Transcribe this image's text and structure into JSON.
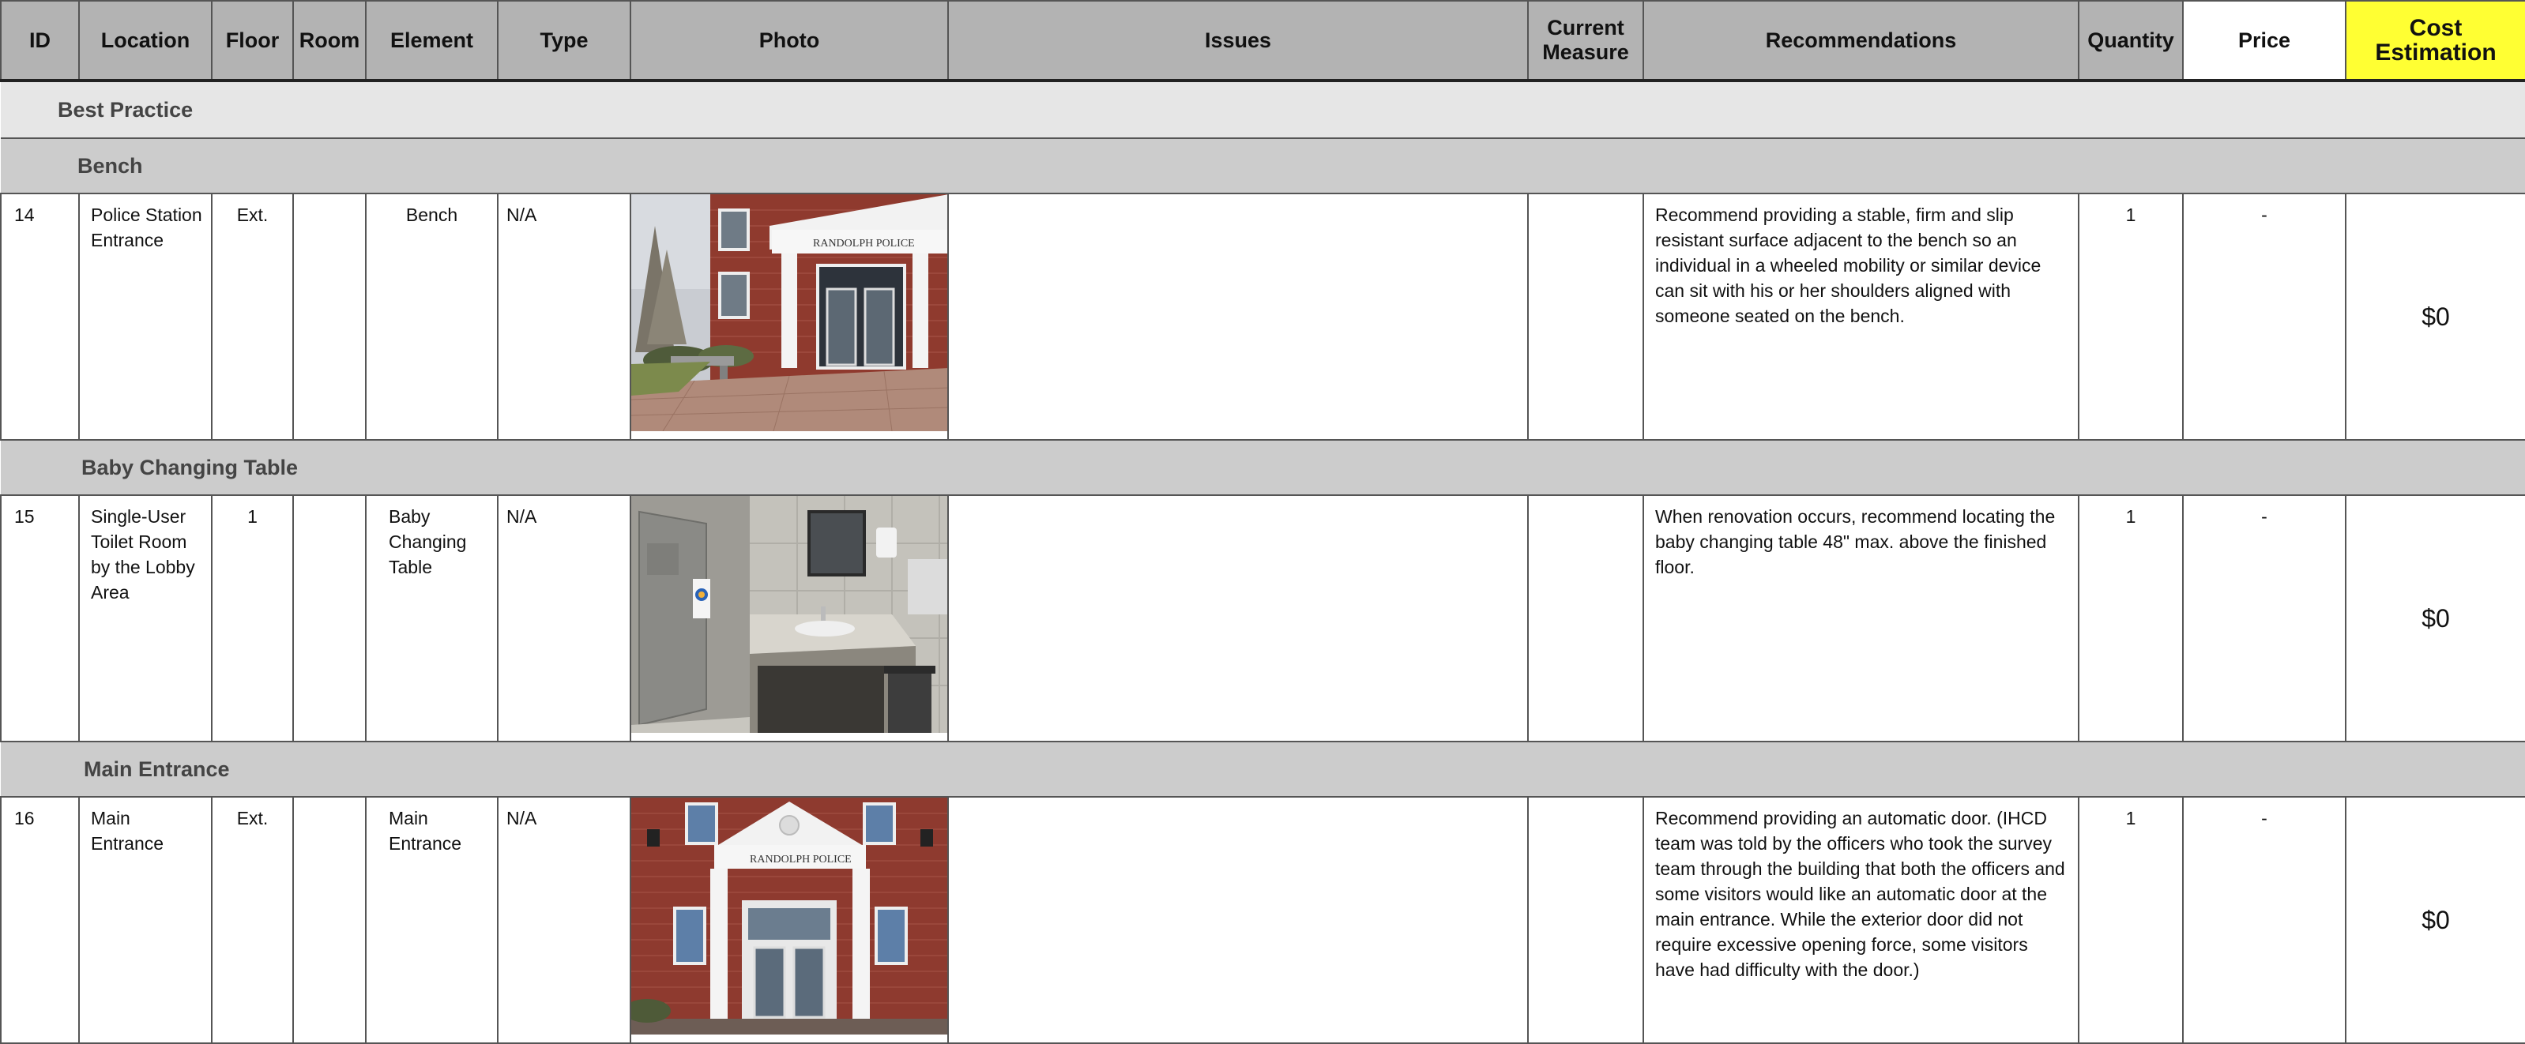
{
  "columns": {
    "id": "ID",
    "location": "Location",
    "floor": "Floor",
    "room": "Room",
    "element": "Element",
    "type": "Type",
    "photo": "Photo",
    "issues": "Issues",
    "current_measure_line1": "Current",
    "current_measure_line2": "Measure",
    "recommendations": "Recommendations",
    "quantity": "Quantity",
    "price": "Price",
    "cost_line1": "Cost",
    "cost_line2": "Estimation"
  },
  "group": {
    "label": "Best Practice"
  },
  "sections": [
    {
      "label": "Bench",
      "row": {
        "id": "14",
        "location_lines": [
          "Police Station",
          "Entrance"
        ],
        "floor": "Ext.",
        "room": "",
        "element_lines": [
          "Bench"
        ],
        "type": "N/A",
        "photo_sign": "RANDOLPH POLICE",
        "issues": "",
        "current_measure": "",
        "recommendation": "Recommend providing a stable, firm and slip resistant surface adjacent to the bench so an individual in a wheeled mobility or similar device can sit with his or her shoulders aligned with someone seated on the bench.",
        "quantity": "1",
        "price": "-",
        "cost": "$0"
      }
    },
    {
      "label": "Baby Changing Table",
      "row": {
        "id": "15",
        "location_lines": [
          "Single-User",
          "Toilet Room",
          "by the Lobby",
          "Area"
        ],
        "floor": "1",
        "room": "",
        "element_lines": [
          "Baby",
          "Changing",
          "Table"
        ],
        "type": "N/A",
        "photo_sign": "",
        "issues": "",
        "current_measure": "",
        "recommendation": "When renovation occurs, recommend locating the baby changing table 48\" max. above the finished floor.",
        "quantity": "1",
        "price": "-",
        "cost": "$0"
      }
    },
    {
      "label": "Main Entrance",
      "row": {
        "id": "16",
        "location_lines": [
          "Main",
          "Entrance"
        ],
        "floor": "Ext.",
        "room": "",
        "element_lines": [
          "Main",
          "Entrance"
        ],
        "type": "N/A",
        "photo_sign": "RANDOLPH POLICE",
        "issues": "",
        "current_measure": "",
        "recommendation": "Recommend providing an automatic door. (IHCD team was told by the officers who took the survey team through the building that both the officers and some visitors would like an automatic door at the main entrance. While the exterior door did not require excessive opening force, some visitors have had difficulty with the door.)",
        "quantity": "1",
        "price": "-",
        "cost": "$0"
      }
    }
  ]
}
